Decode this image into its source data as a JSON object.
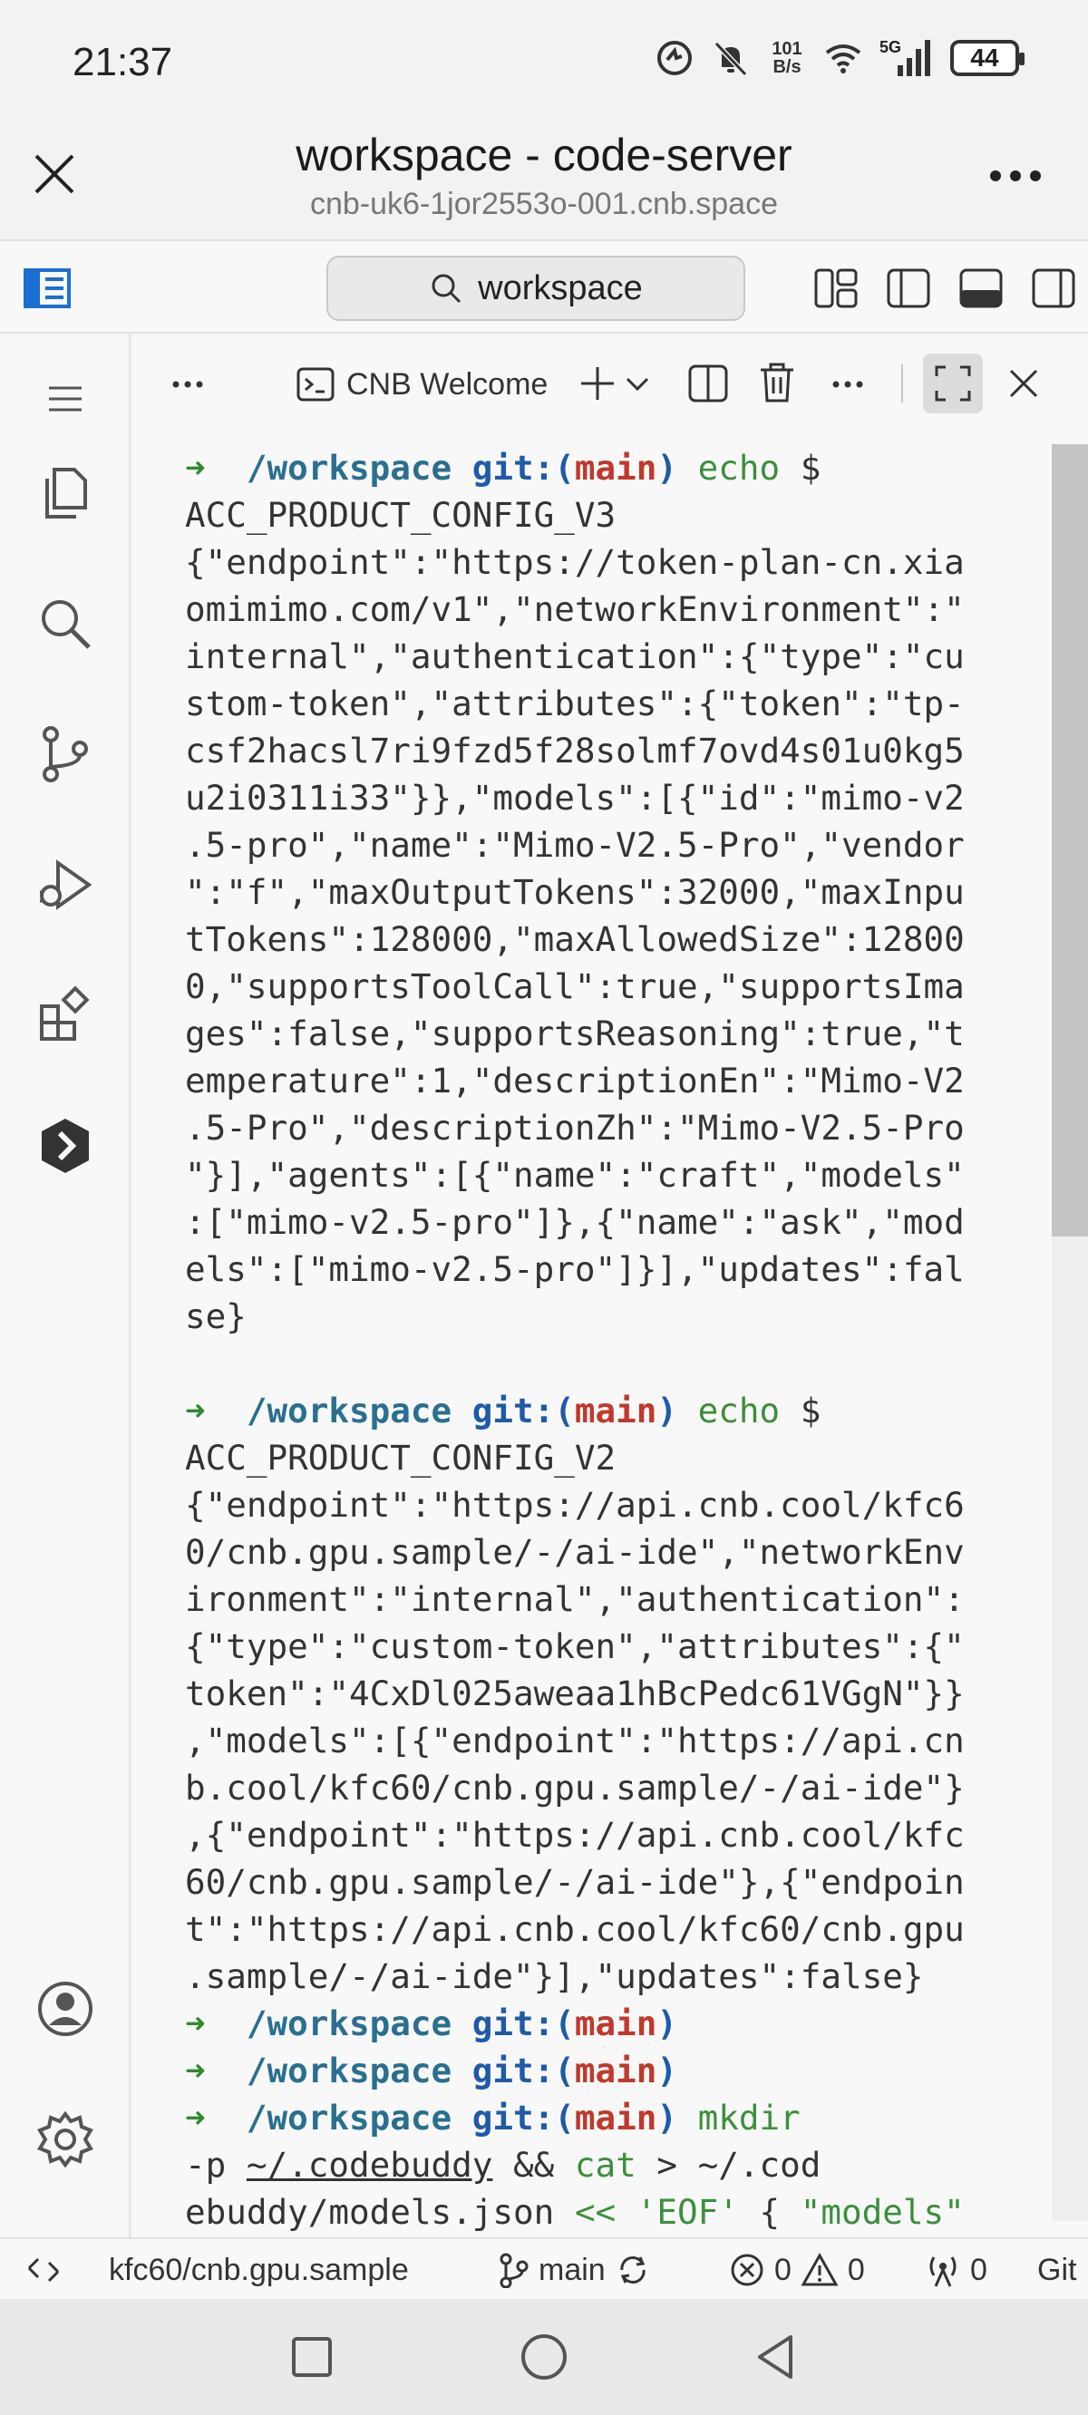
{
  "status_bar": {
    "time": "21:37",
    "net_speed_value": "101",
    "net_speed_unit": "B/s",
    "network_type": "5G",
    "battery": "44"
  },
  "browser": {
    "title": "workspace - code-server",
    "url": "cnb-uk6-1jor2553o-001.cnb.space"
  },
  "vscode": {
    "search_text": "workspace",
    "terminal_tab": "CNB Welcome"
  },
  "terminal": {
    "prompt_dir": "/workspace",
    "git_prefix": "git:(",
    "branch": "main",
    "git_suffix": ")",
    "echo_cmd": "echo",
    "echo_arg": " $",
    "var_v3": "ACC_PRODUCT_CONFIG_V3",
    "output_v3": [
      "{\"endpoint\":\"https://token-plan-cn.xia",
      "omimimo.com/v1\",\"networkEnvironment\":\"",
      "internal\",\"authentication\":{\"type\":\"cu",
      "stom-token\",\"attributes\":{\"token\":\"tp-",
      "csf2hacsl7ri9fzd5f28solmf7ovd4s01u0kg5",
      "u2i0311i33\"}},\"models\":[{\"id\":\"mimo-v2",
      ".5-pro\",\"name\":\"Mimo-V2.5-Pro\",\"vendor",
      "\":\"f\",\"maxOutputTokens\":32000,\"maxInpu",
      "tTokens\":128000,\"maxAllowedSize\":12800",
      "0,\"supportsToolCall\":true,\"supportsIma",
      "ges\":false,\"supportsReasoning\":true,\"t",
      "emperature\":1,\"descriptionEn\":\"Mimo-V2",
      ".5-Pro\",\"descriptionZh\":\"Mimo-V2.5-Pro",
      "\"}],\"agents\":[{\"name\":\"craft\",\"models\"",
      ":[\"mimo-v2.5-pro\"]},{\"name\":\"ask\",\"mod",
      "els\":[\"mimo-v2.5-pro\"]}],\"updates\":fal",
      "se}"
    ],
    "var_v2": "ACC_PRODUCT_CONFIG_V2",
    "output_v2": [
      "{\"endpoint\":\"https://api.cnb.cool/kfc6",
      "0/cnb.gpu.sample/-/ai-ide\",\"networkEnv",
      "ironment\":\"internal\",\"authentication\":",
      "{\"type\":\"custom-token\",\"attributes\":{\"",
      "token\":\"4CxDl025aweaa1hBcPedc61VGgN\"}}",
      ",\"models\":[{\"endpoint\":\"https://api.cn",
      "b.cool/kfc60/cnb.gpu.sample/-/ai-ide\"}",
      ",{\"endpoint\":\"https://api.cnb.cool/kfc",
      "60/cnb.gpu.sample/-/ai-ide\"},{\"endpoin",
      "t\":\"https://api.cnb.cool/kfc60/cnb.gpu",
      ".sample/-/ai-ide\"}],\"updates\":false}"
    ],
    "mkdir_cmd": "mkdir",
    "mkdir_line2_a": "-p ",
    "mkdir_path": "~/.codebuddy",
    "mkdir_line2_b": " && ",
    "cat_cmd": "cat",
    "mkdir_line2_c": " > ~/.cod",
    "line3_a": "ebuddy/models.json ",
    "heredoc": "<< 'EOF'",
    "line3_b": " { ",
    "models_str": "\"models\""
  },
  "statusbar_bottom": {
    "remote": "kfc60/cnb.gpu.sample",
    "branch": "main",
    "errors": "0",
    "warnings": "0",
    "ports": "0",
    "git": "Git"
  }
}
